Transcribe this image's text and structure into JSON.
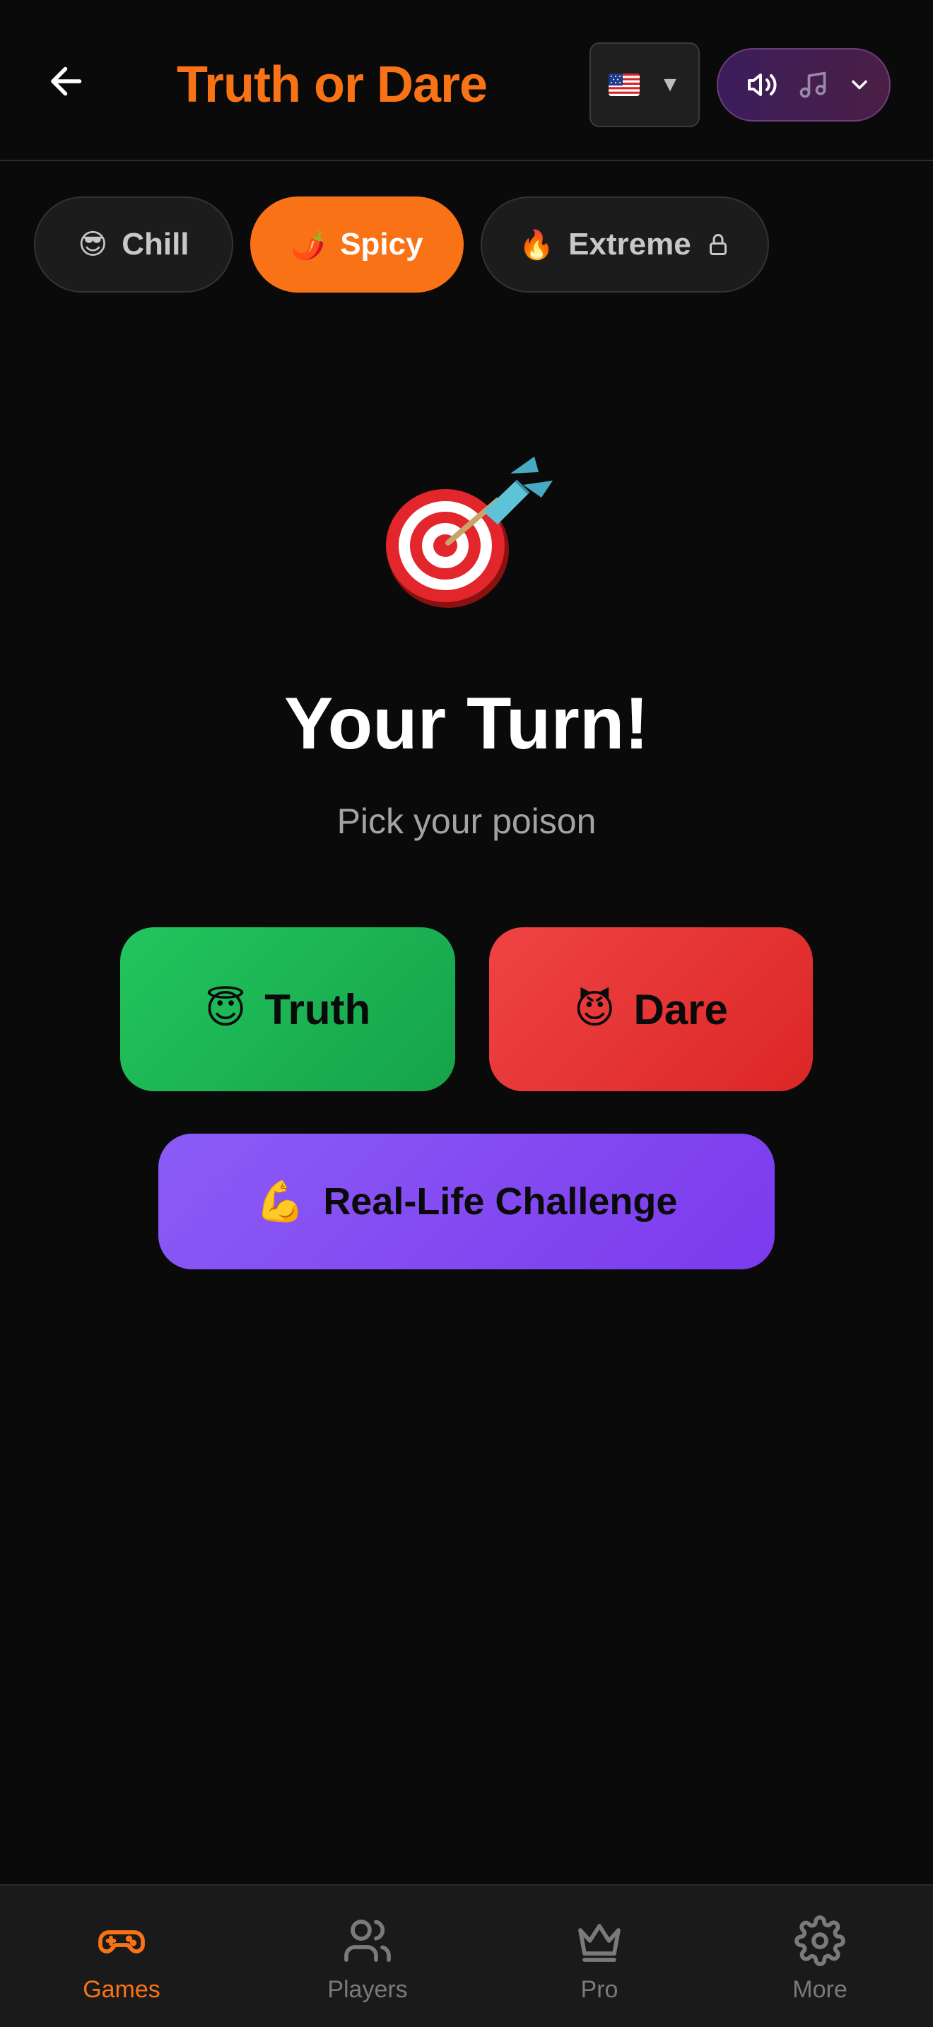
{
  "header": {
    "title": "Truth or Dare",
    "back_icon": "arrow-left-icon",
    "language": {
      "flag_icon": "us-flag-icon",
      "caret": "▼"
    },
    "sound": {
      "icons": [
        "speaker-icon",
        "music-note-icon",
        "chevron-down-icon"
      ]
    }
  },
  "levels": [
    {
      "emoji": "😎",
      "label": "Chill",
      "active": false
    },
    {
      "emoji": "🌶️",
      "label": "Spicy",
      "active": true
    },
    {
      "emoji": "🔥",
      "label": "Extreme",
      "active": false,
      "locked": true
    }
  ],
  "main": {
    "hero_icon": "dart-target-icon",
    "heading": "Your Turn!",
    "subheading": "Pick your poison",
    "buttons": {
      "truth": {
        "emoji": "😇",
        "label": "Truth"
      },
      "dare": {
        "emoji": "😈",
        "label": "Dare"
      },
      "challenge": {
        "emoji": "💪",
        "label": "Real-Life Challenge"
      }
    }
  },
  "nav": [
    {
      "label": "Games",
      "icon": "gamepad-icon",
      "active": true
    },
    {
      "label": "Players",
      "icon": "users-icon",
      "active": false
    },
    {
      "label": "Pro",
      "icon": "crown-icon",
      "active": false
    },
    {
      "label": "More",
      "icon": "gear-icon",
      "active": false
    }
  ],
  "colors": {
    "background": "#0a0a0a",
    "accent": "#f97316",
    "truth": "#22c55e",
    "dare": "#ef4444",
    "challenge": "#8b5cf6",
    "nav_inactive": "#7a7a7a"
  }
}
